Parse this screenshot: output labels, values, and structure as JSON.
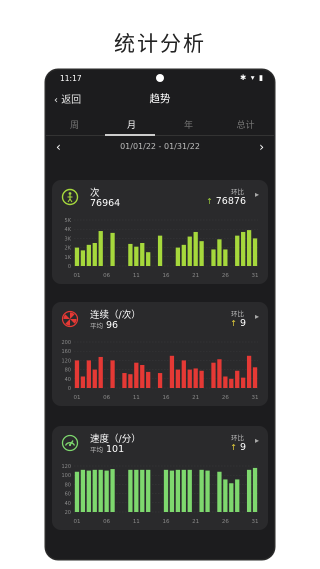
{
  "promo_title": "统计分析",
  "status_bar": {
    "time": "11:17",
    "icons": "✱ ▾ ▮"
  },
  "nav": {
    "back_label": "返回",
    "title": "趋势"
  },
  "tabs": [
    {
      "label": "周",
      "active": false
    },
    {
      "label": "月",
      "active": true
    },
    {
      "label": "年",
      "active": false
    },
    {
      "label": "总计",
      "active": false
    }
  ],
  "date_range": "01/01/22 - 01/31/22",
  "x_tick_labels": [
    "01",
    "06",
    "11",
    "16",
    "21",
    "26",
    "31"
  ],
  "cards": [
    {
      "id": "count",
      "name": "次",
      "value": "76964",
      "compare_label": "环比",
      "compare_value": "76876",
      "compare_color": "#9ccc3c",
      "color": "#a6d83c",
      "icon": "jump-count-icon",
      "y_ticks": [
        "5K",
        "4K",
        "3K",
        "2K",
        "1K",
        "0"
      ],
      "ymax": 5000,
      "chart_data": {
        "type": "bar",
        "x": [
          1,
          2,
          3,
          4,
          5,
          6,
          7,
          8,
          9,
          10,
          11,
          12,
          13,
          14,
          15,
          16,
          17,
          18,
          19,
          20,
          21,
          22,
          23,
          24,
          25,
          26,
          27,
          28,
          29,
          30,
          31
        ],
        "values": [
          2000,
          1700,
          2300,
          2500,
          3800,
          0,
          3600,
          0,
          0,
          2400,
          2100,
          2500,
          1500,
          0,
          3300,
          0,
          0,
          2000,
          2300,
          3200,
          3700,
          2700,
          0,
          1800,
          2900,
          1800,
          0,
          3300,
          3700,
          3900,
          3000
        ]
      }
    },
    {
      "id": "continuous",
      "name": "连续（/次）",
      "avg_label": "平均",
      "avg_value": "96",
      "compare_label": "环比",
      "compare_value": "9",
      "compare_color": "#e6d03c",
      "color": "#e53935",
      "icon": "continuous-jump-icon",
      "y_ticks": [
        "200",
        "160",
        "120",
        "80",
        "40",
        "0"
      ],
      "ymax": 200,
      "chart_data": {
        "type": "bar",
        "x": [
          1,
          2,
          3,
          4,
          5,
          6,
          7,
          8,
          9,
          10,
          11,
          12,
          13,
          14,
          15,
          16,
          17,
          18,
          19,
          20,
          21,
          22,
          23,
          24,
          25,
          26,
          27,
          28,
          29,
          30,
          31
        ],
        "values": [
          120,
          50,
          120,
          80,
          135,
          0,
          120,
          0,
          65,
          60,
          110,
          100,
          70,
          0,
          65,
          0,
          140,
          80,
          120,
          80,
          85,
          75,
          0,
          110,
          125,
          50,
          40,
          75,
          45,
          140,
          90
        ]
      }
    },
    {
      "id": "speed",
      "name": "速度（/分）",
      "avg_label": "平均",
      "avg_value": "101",
      "compare_label": "环比",
      "compare_value": "9",
      "compare_color": "#e6d03c",
      "color": "#7ed86e",
      "icon": "speedometer-icon",
      "y_ticks": [
        "120",
        "100",
        "80",
        "60",
        "40",
        "20"
      ],
      "ymax": 120,
      "chart_data": {
        "type": "bar",
        "x": [
          1,
          2,
          3,
          4,
          5,
          6,
          7,
          8,
          9,
          10,
          11,
          12,
          13,
          14,
          15,
          16,
          17,
          18,
          19,
          20,
          21,
          22,
          23,
          24,
          25,
          26,
          27,
          28,
          29,
          30,
          31
        ],
        "values": [
          105,
          110,
          108,
          110,
          110,
          108,
          112,
          0,
          0,
          110,
          110,
          110,
          110,
          0,
          0,
          110,
          108,
          110,
          110,
          110,
          0,
          110,
          108,
          0,
          105,
          85,
          75,
          85,
          0,
          110,
          115
        ]
      }
    }
  ]
}
